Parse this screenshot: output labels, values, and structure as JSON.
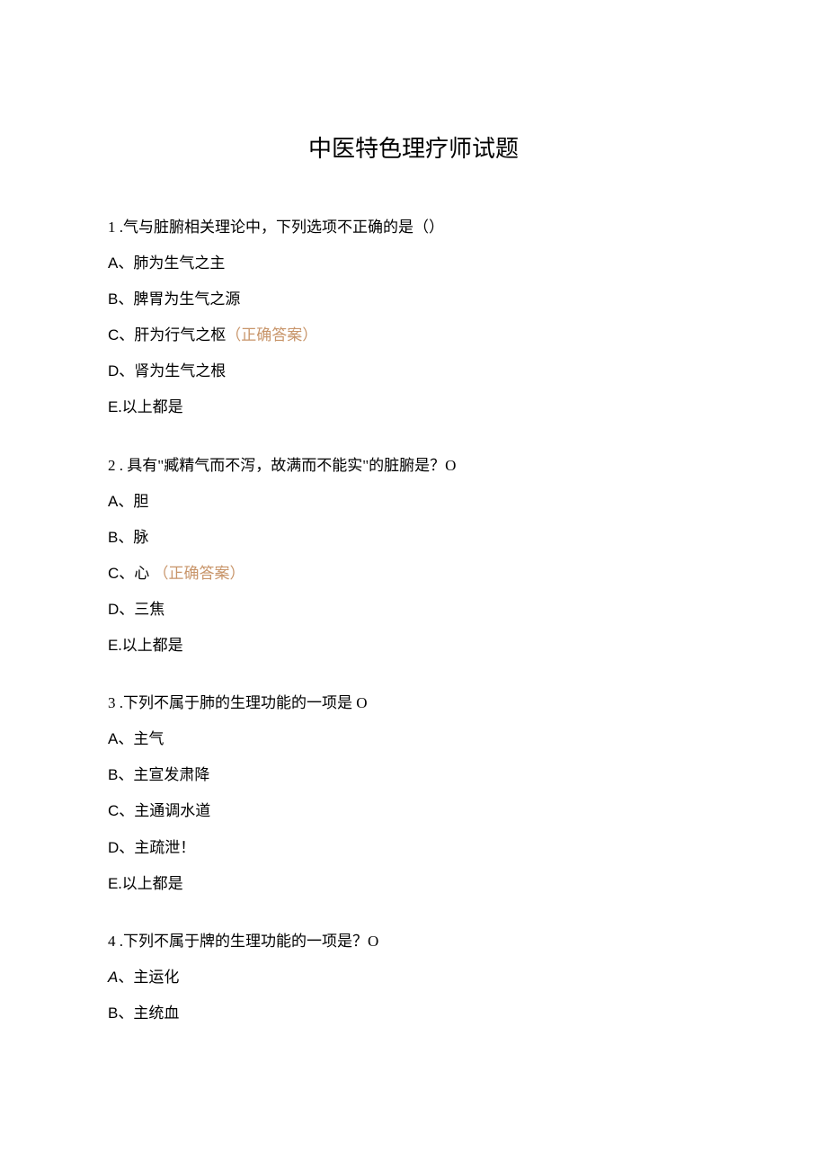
{
  "title": "中医特色理疗师试题",
  "questions": [
    {
      "num": "1",
      "text": " .气与脏腑相关理论中，下列选项不正确的是（）",
      "options": [
        {
          "label": "A",
          "text": "、肺为生气之主",
          "latin": true
        },
        {
          "label": "B",
          "text": "、脾胃为生气之源",
          "latin": true
        },
        {
          "label": "C",
          "text": "、肝为行气之枢",
          "latin": true,
          "correct": "（正确答案）"
        },
        {
          "label": "D",
          "text": "、肾为生气之根",
          "latin": true
        },
        {
          "label": "E",
          "text": ".以上都是",
          "latin": true
        }
      ]
    },
    {
      "num": "2",
      "text": " . 具有\"臧精气而不泻，故满而不能实\"的脏腑是？O",
      "options": [
        {
          "label": "A",
          "text": "、胆",
          "latin": true
        },
        {
          "label": "B",
          "text": "、脉",
          "latin": true
        },
        {
          "label": "C",
          "text": "、心 ",
          "latin": true,
          "correct": "（正确答案）"
        },
        {
          "label": "D",
          "text": "、三焦",
          "latin": true
        },
        {
          "label": "E",
          "text": ".以上都是",
          "latin": true
        }
      ]
    },
    {
      "num": "3",
      "text": " .下列不属于肺的生理功能的一项是 O",
      "options": [
        {
          "label": "A",
          "text": "、主气",
          "latin": true
        },
        {
          "label": "B",
          "text": "、主宣发肃降",
          "latin": true
        },
        {
          "label": "C",
          "text": "、主通调水道",
          "latin": true
        },
        {
          "label": "D",
          "text": "、主疏泄！",
          "latin": true
        },
        {
          "label": "E",
          "text": ".以上都是",
          "latin": true
        }
      ]
    },
    {
      "num": "4",
      "text": " .下列不属于牌的生理功能的一项是？O",
      "options": [
        {
          "label": "A",
          "text": "、主运化",
          "italic": true
        },
        {
          "label": "B",
          "text": "、主统血",
          "latin": true
        }
      ]
    }
  ]
}
